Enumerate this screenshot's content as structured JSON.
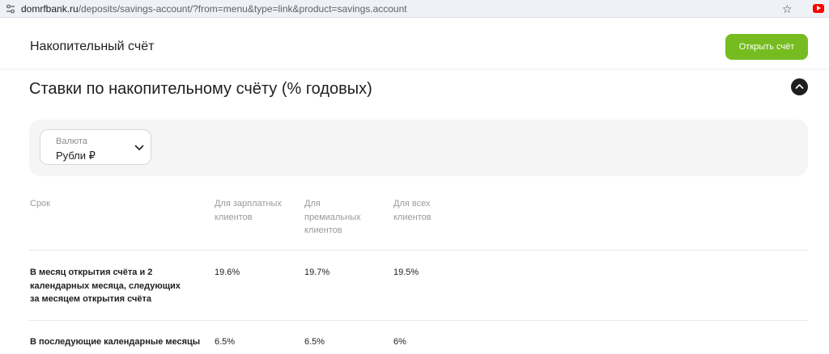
{
  "browser": {
    "url_host": "domrfbank.ru",
    "url_path": "/deposits/savings-account/?from=menu&type=link&product=savings.account"
  },
  "header": {
    "title": "Накопительный счёт",
    "open_button": "Открыть счёт"
  },
  "section": {
    "title": "Ставки по накопительному счёту (% годовых)"
  },
  "filter": {
    "currency_label": "Валюта",
    "currency_value": "Рубли ₽"
  },
  "table": {
    "headers": {
      "term": "Срок",
      "salary": "Для зарплатных клиентов",
      "premium": "Для премиальных клиентов",
      "all": "Для всех клиентов"
    },
    "rows": [
      {
        "term": "В месяц открытия счёта и 2 календарных месяца, следующих за месяцем открытия счёта",
        "salary": "19.6%",
        "premium": "19.7%",
        "all": "19.5%"
      },
      {
        "term": "В последующие календарные месяцы",
        "salary": "6.5%",
        "premium": "6.5%",
        "all": "6%"
      }
    ]
  },
  "colors": {
    "accent_green": "#76bc21",
    "panel_gray": "#f5f5f5",
    "text_dark": "#1f1f1f",
    "text_muted": "#9a9a9a"
  },
  "icons": [
    "site-settings-icon",
    "bookmark-star-icon",
    "youtube-extension-icon",
    "chevron-up-icon",
    "chevron-down-icon"
  ]
}
